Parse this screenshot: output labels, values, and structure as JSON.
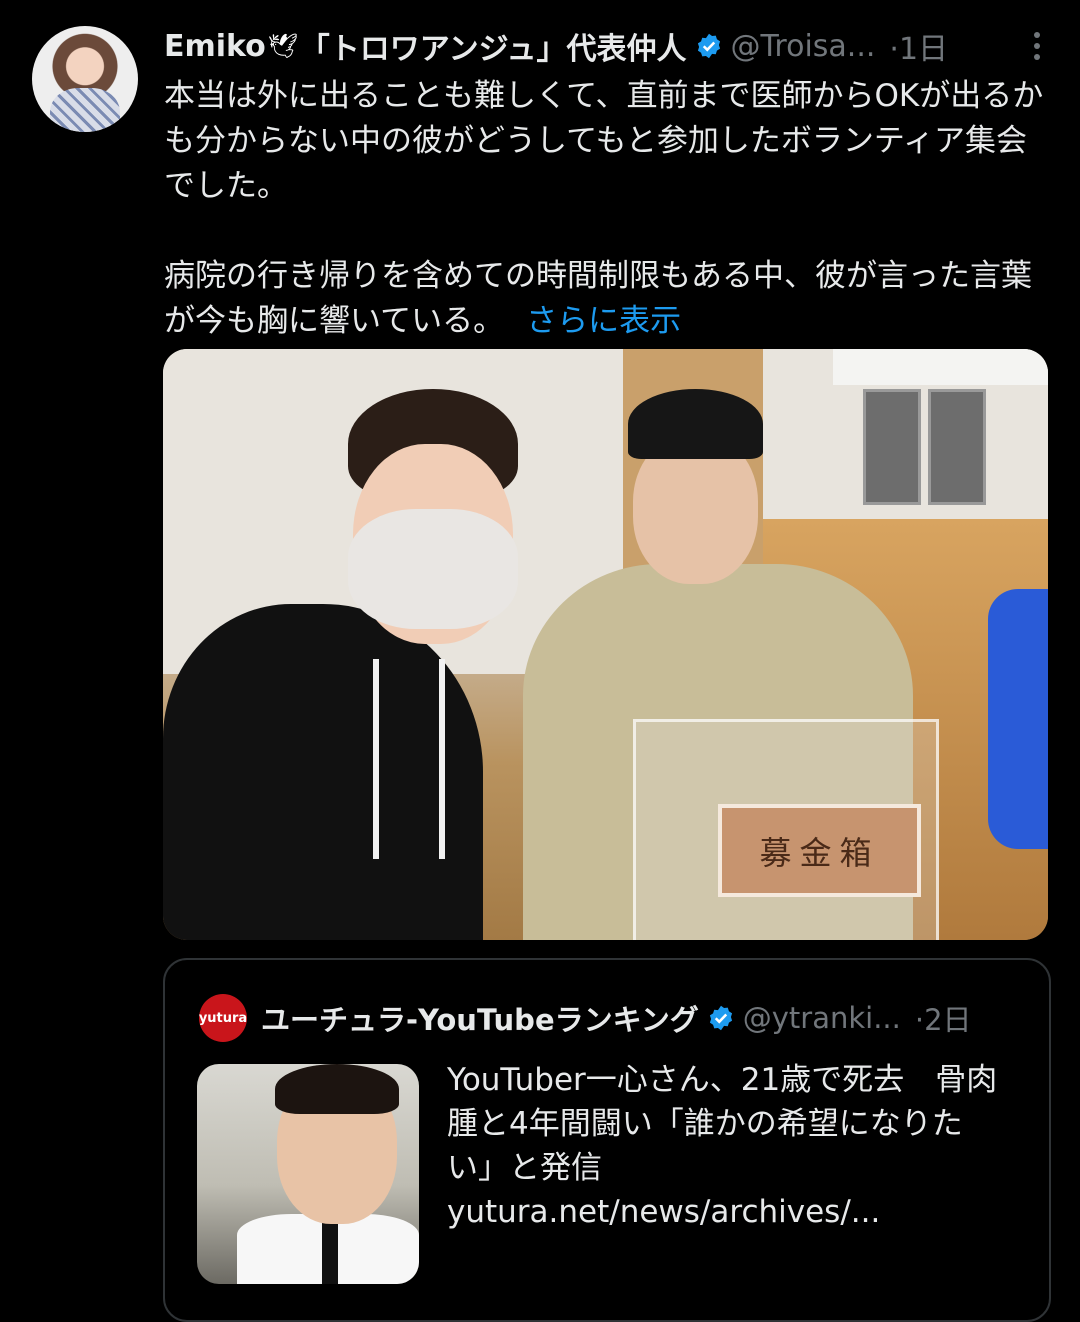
{
  "tweet": {
    "author_name": "Emiko",
    "author_title": "「トロワアンジュ」代表仲人",
    "handle": "@Troisa...",
    "time": "·1日",
    "paragraph1": "本当は外に出ることも難しくて、直前まで医師からOKが出るかも分からない中の彼がどうしてもと参加したボランティア集会でした。",
    "paragraph2": "病院の行き帰りを含めての時間制限もある中、彼が言った言葉が今も胸に響いている。",
    "show_more": "さらに表示",
    "photo_box_label": "募金箱"
  },
  "quoted": {
    "logo_text": "yutura",
    "author_name": "ユーチュラ-YouTubeランキング",
    "handle": "@ytranki...",
    "time": "·2日",
    "headline_line1": "YouTuber一心さん、21歳で死去　骨肉",
    "headline_line2": "腫と4年間闘い「誰かの希望になりた",
    "headline_line3": "い」と発信",
    "link": "yutura.net/news/archives/..."
  },
  "colors": {
    "background": "#000000",
    "text": "#e7e9ea",
    "muted": "#71767b",
    "link": "#1d9bf0",
    "verified": "#1d9bf0",
    "border": "#2f3336"
  }
}
